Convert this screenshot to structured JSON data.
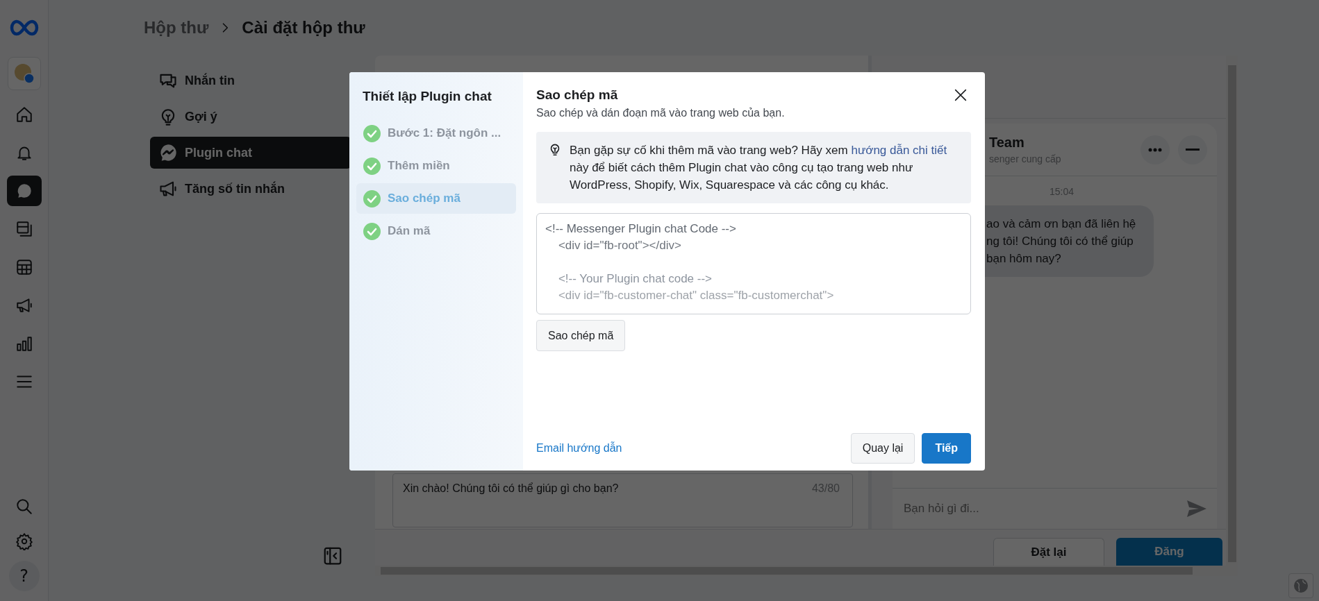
{
  "rail": {
    "items": [
      {
        "kind": "home",
        "selected": false
      },
      {
        "kind": "bell",
        "selected": false
      },
      {
        "kind": "inbox",
        "selected": true
      },
      {
        "kind": "pages",
        "selected": false
      },
      {
        "kind": "table",
        "selected": false
      },
      {
        "kind": "megaphone",
        "selected": false
      },
      {
        "kind": "chart",
        "selected": false
      },
      {
        "kind": "menu",
        "selected": false
      }
    ],
    "bottom_items": [
      {
        "kind": "search",
        "selected": false
      },
      {
        "kind": "gear",
        "selected": false
      }
    ],
    "help_label": "?"
  },
  "breadcrumb": {
    "parent": "Hộp thư",
    "current": "Cài đặt hộp thư"
  },
  "settings_nav": {
    "items": [
      {
        "kind": "chat",
        "label": "Nhắn tin",
        "selected": false
      },
      {
        "kind": "bulb",
        "label": "Gợi ý",
        "selected": false
      },
      {
        "kind": "messenger",
        "label": "Plugin chat",
        "selected": true
      },
      {
        "kind": "megaphone",
        "label": "Tăng số tin nhắn",
        "selected": false
      }
    ]
  },
  "editor": {
    "greeting_value": "Xin chào! Chúng tôi có thể giúp gì cho bạn?",
    "char_count": "43/80"
  },
  "preview": {
    "chat_title": "Team",
    "chat_subtitle": "senger cung cấp",
    "time": "15:04",
    "bubble_lines": [
      "ao và cảm ơn bạn đã liên hệ",
      "ng tôi! Chúng tôi có thể giúp",
      "bạn hôm nay?"
    ],
    "input_placeholder": "Bạn hỏi gì đi..."
  },
  "footer_buttons": [
    {
      "label": "Đặt lại",
      "kind": "secondary"
    },
    {
      "label": "Đăng",
      "kind": "primary"
    }
  ],
  "modal": {
    "title": "Thiết lập Plugin chat",
    "steps": [
      {
        "label": "Bước 1: Đặt ngôn ...",
        "done": true,
        "selected": false
      },
      {
        "label": "Thêm miền",
        "done": true,
        "selected": false
      },
      {
        "label": "Sao chép mã",
        "done": true,
        "selected": true
      },
      {
        "label": "Dán mã",
        "done": true,
        "selected": false
      }
    ],
    "heading": "Sao chép mã",
    "subheading": "Sao chép và dán đoạn mã vào trang web của bạn.",
    "info": {
      "before": "Bạn gặp sự cố khi thêm mã vào trang web? Hãy xem",
      "link": "hướng dẫn chi tiết",
      "after": "này để biết cách thêm Plugin chat vào công cụ tạo trang web như WordPress, Shopify, Wix, Squarespace và các công cụ khác."
    },
    "code_blocks": [
      [
        "<!-- Messenger Plugin chat Code -->",
        "    <div id=\"fb-root\"></div>"
      ],
      [
        "    <!-- Your Plugin chat code -->",
        "    <div id=\"fb-customer-chat\" class=\"fb-customerchat\">"
      ]
    ],
    "copy_button": "Sao chép mã",
    "email_link": "Email hướng dẫn",
    "buttons": [
      {
        "label": "Quay lại",
        "kind": "secondary"
      },
      {
        "label": "Tiếp",
        "kind": "primary"
      }
    ]
  }
}
